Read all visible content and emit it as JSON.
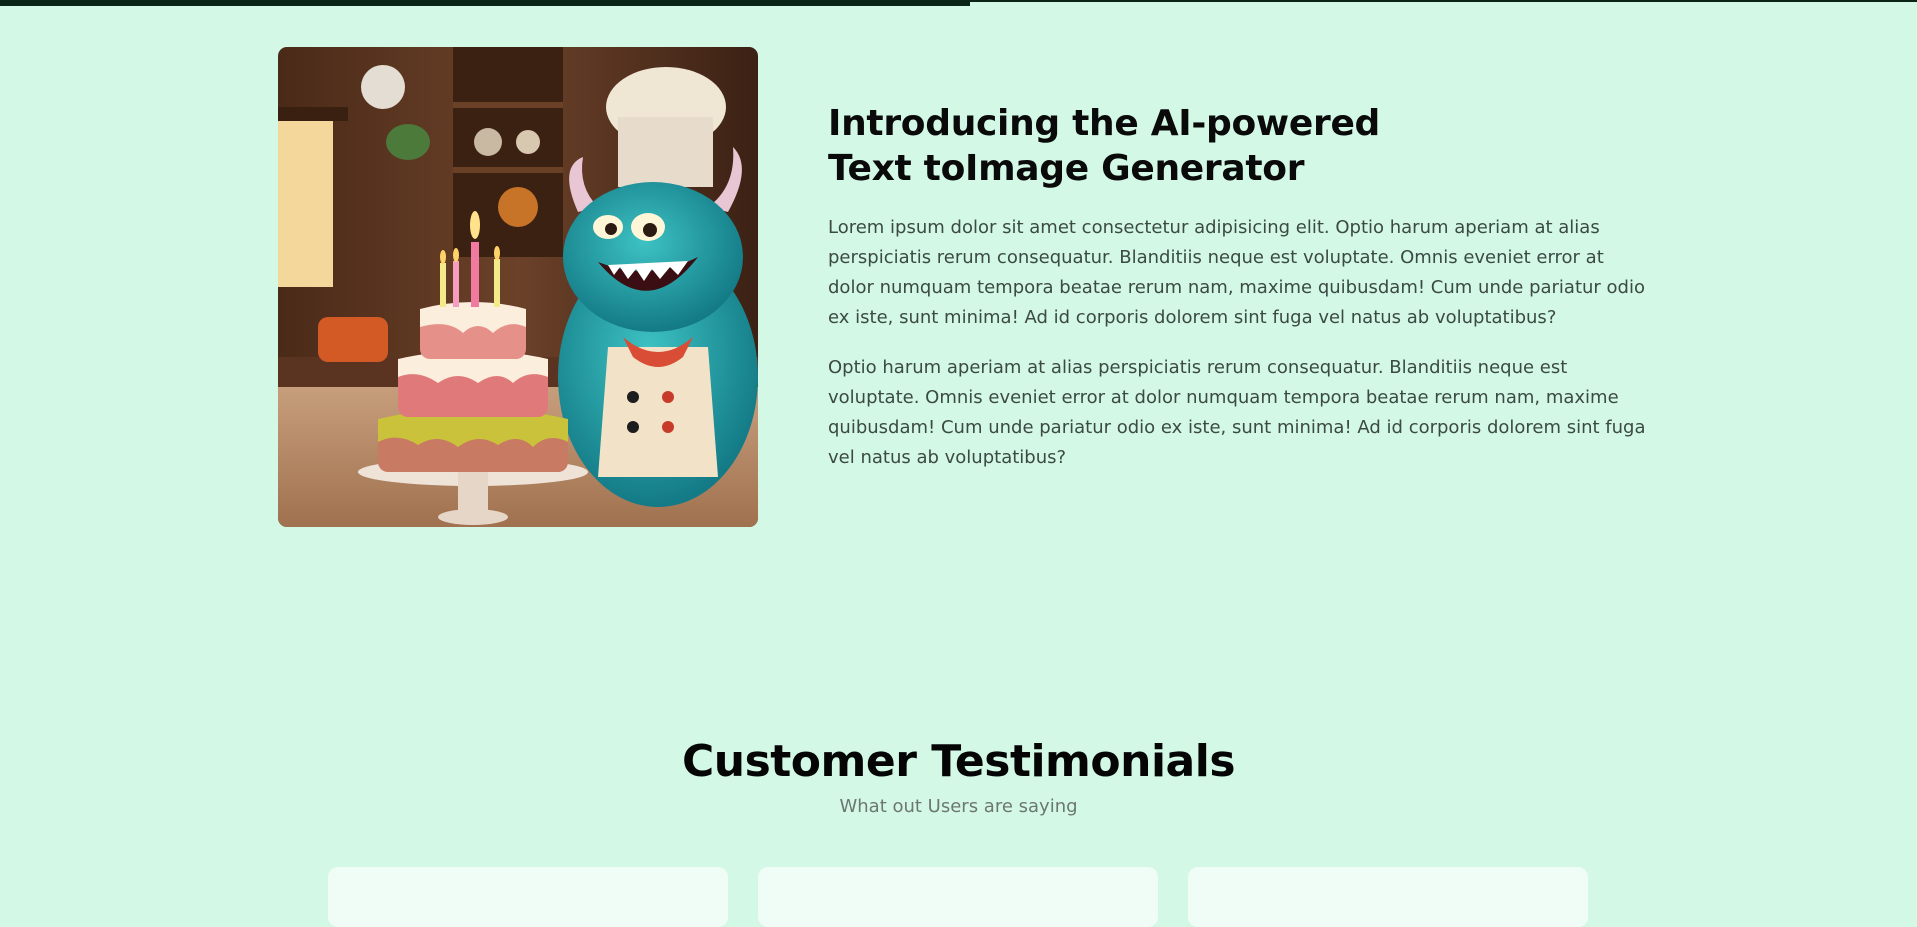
{
  "page": {
    "scroll_progress": 0.506,
    "colors": {
      "background": "#d3f8e6",
      "progress_bar": "#0b2418",
      "card_background": "#effdf6",
      "heading": "#0a0a0a",
      "body_text": "#3c4a44",
      "muted_text": "#6d7771"
    }
  },
  "feature": {
    "image_subject": "monster-chef-with-birthday-cake",
    "title": "Introducing the AI-powered Text toImage Generator",
    "paragraphs": [
      "Lorem ipsum dolor sit amet consectetur adipisicing elit. Optio harum aperiam at alias perspiciatis rerum consequatur. Blanditiis neque est voluptate. Omnis eveniet error at dolor numquam tempora beatae rerum nam, maxime quibusdam! Cum unde pariatur odio ex iste, sunt minima! Ad id corporis dolorem sint fuga vel natus ab voluptatibus?",
      "Optio harum aperiam at alias perspiciatis rerum consequatur. Blanditiis neque est voluptate. Omnis eveniet error at dolor numquam tempora beatae rerum nam, maxime quibusdam! Cum unde pariatur odio ex iste, sunt minima! Ad id corporis dolorem sint fuga vel natus ab voluptatibus?"
    ]
  },
  "testimonials": {
    "title": "Customer Testimonials",
    "subtitle": "What out Users are saying",
    "card_count": 3
  }
}
